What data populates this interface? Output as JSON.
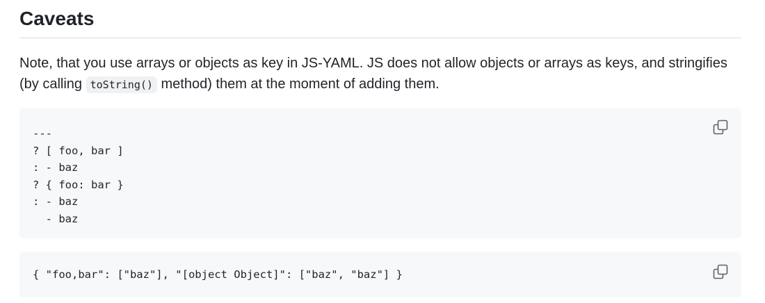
{
  "section": {
    "heading": "Caveats"
  },
  "paragraph": {
    "text_before": "Note, that you use arrays or objects as key in JS-YAML. JS does not allow objects or arrays as keys, and stringifies (by calling ",
    "inline_code": "toString()",
    "text_after": " method) them at the moment of adding them."
  },
  "yaml_block": {
    "lines": [
      "---",
      "? [ foo, bar ]",
      ": - baz",
      "? { foo: bar }",
      ": - baz",
      "  - baz"
    ],
    "copy_icon": "copy-icon"
  },
  "js_block": {
    "lines": [
      "{ \"foo,bar\": [\"baz\"], \"[object Object]\": [\"baz\", \"baz\"] }"
    ],
    "copy_icon": "copy-icon"
  }
}
